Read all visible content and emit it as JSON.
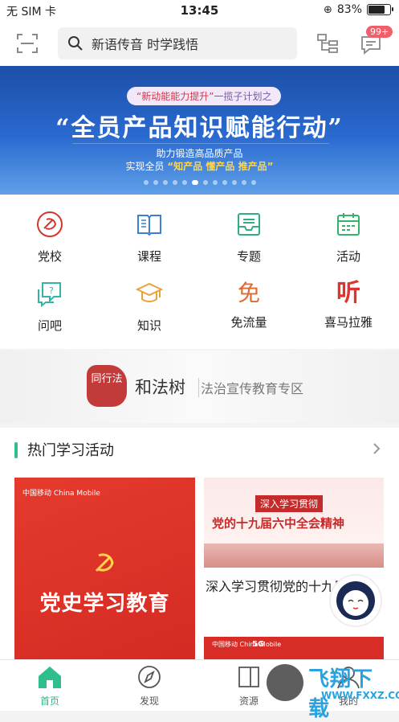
{
  "status": {
    "carrier": "无 SIM 卡",
    "time": "13:45",
    "battery": "83%",
    "battery_level": 0.83
  },
  "header": {
    "search_placeholder": "新语传音 时学践悟",
    "badge": "99+"
  },
  "banner": {
    "tagline_highlight": "“新动能能力提升”",
    "tagline_rest": "一揽子计划之",
    "title": "“全员产品知识赋能行动”",
    "sub1": "助力锻造高品质产品",
    "sub2_prefix": "实现全员",
    "sub2_highlight": "“知产品 懂产品 推产品”",
    "slide_count": 12,
    "active_slide": 5
  },
  "menu": [
    {
      "label": "党校",
      "icon": "party-icon"
    },
    {
      "label": "课程",
      "icon": "book-icon"
    },
    {
      "label": "专题",
      "icon": "inbox-icon"
    },
    {
      "label": "活动",
      "icon": "calendar-icon"
    },
    {
      "label": "问吧",
      "icon": "question-icon"
    },
    {
      "label": "知识",
      "icon": "graduation-cap-icon"
    },
    {
      "label": "免流量",
      "icon": "free-data-icon",
      "glyph": "免"
    },
    {
      "label": "喜马拉雅",
      "icon": "himalaya-icon",
      "glyph": "听"
    }
  ],
  "law": {
    "seal_text": "同行法",
    "name": "和法树",
    "subtitle": "法治宣传教育专区"
  },
  "section": {
    "title": "热门学习活动",
    "card1": {
      "logo": "中国移动 China Mobile",
      "title": "党史学习教育"
    },
    "card2": {
      "poster_line1": "深入学习贯彻",
      "poster_line2": "党的十九届六中全会精神",
      "caption": "深入学习贯彻党的十九届六中全会精神"
    },
    "card3": {
      "logo": "中国移动 China Mobile",
      "mark": "5G"
    }
  },
  "tabs": [
    {
      "label": "首页",
      "icon": "home-icon",
      "active": true
    },
    {
      "label": "发现",
      "icon": "compass-icon",
      "active": false
    },
    {
      "label": "资源",
      "icon": "resource-icon",
      "active": false
    },
    {
      "label": "我的",
      "icon": "user-icon",
      "active": false
    }
  ],
  "watermark": {
    "brand": "飞翔下载",
    "domain": "WWW.FXXZ.COM"
  },
  "colors": {
    "accent": "#2fbf8c",
    "banner_blue": "#1c4fa8",
    "party_red": "#d52a23",
    "badge": "#f0606a"
  }
}
